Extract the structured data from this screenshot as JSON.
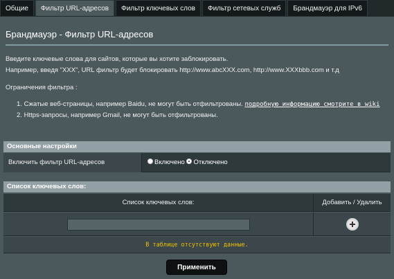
{
  "tabs": [
    {
      "label": "Общие"
    },
    {
      "label": "Фильтр URL-адресов"
    },
    {
      "label": "Фильтр ключевых слов"
    },
    {
      "label": "Фильтр сетевых служб"
    },
    {
      "label": "Брандмауэр для IPv6"
    }
  ],
  "active_tab": "Фильтр URL-адресов",
  "page": {
    "title": "Брандмауэр - Фильтр URL-адресов",
    "desc_line1": "Введите ключевые слова для сайтов, которые вы хотите заблокировать.",
    "desc_line2": "Например, введя \"XXX\", URL фильтр будет блокировать http://www.abcXXX.com, http://www.XXXbbb.com и т.д",
    "limits_label": "Ограничения фильтра :",
    "limits": [
      {
        "num": "1.",
        "text": "Сжатые веб-страницы, например Baidu, не могут быть отфильтрованы.",
        "link": "подробную информацию смотрите в wiki"
      },
      {
        "num": "2.",
        "text": "Https-запросы, например Gmail, не могут быть отфильтрованы."
      }
    ]
  },
  "basic": {
    "header": "Основные настройки",
    "enable_label": "Включить фильтр URL-адресов",
    "option_on": "Включено",
    "option_off": "Отключено",
    "selected": "Отключено"
  },
  "keywords": {
    "header": "Список ключевых слов:",
    "col_list": "Список ключевых слов:",
    "col_action": "Добавить / Удалить",
    "input_value": "",
    "empty_message": "В таблице отсутствуют данные."
  },
  "apply_label": "Применить",
  "colors": {
    "background": "#21292b",
    "panel": "#4b585c",
    "section_header": "#92a0a5",
    "empty_text": "#f0c000"
  }
}
